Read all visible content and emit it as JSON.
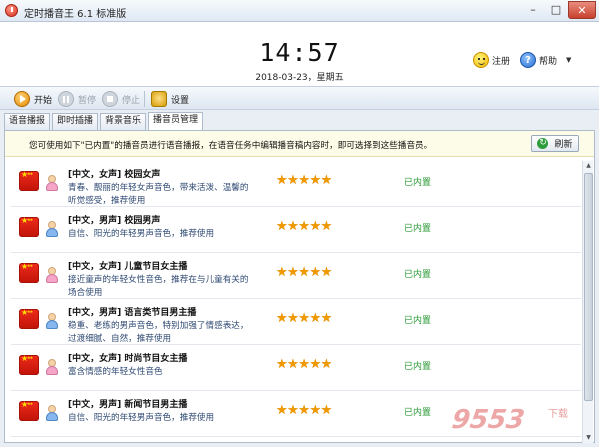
{
  "window": {
    "title": "定时播音王 6.1 标准版",
    "minimize": "–",
    "maximize": "□",
    "close": "✕"
  },
  "header": {
    "clock": "14:57",
    "date": "2018-03-23，星期五",
    "register_label": "注册",
    "help_label": "帮助",
    "help_caret": "▼"
  },
  "toolbar": {
    "start_label": "开始",
    "pause_label": "暂停",
    "stop_label": "停止",
    "settings_label": "设置"
  },
  "tabs": [
    {
      "label": "语音播报"
    },
    {
      "label": "即时插播"
    },
    {
      "label": "背景音乐"
    },
    {
      "label": "播音员管理",
      "active": true
    }
  ],
  "notice": {
    "text": "您可使用如下\"已内置\"的播音员进行语音播报，在语音任务中编辑播音稿内容时，即可选择到这些播音员。",
    "refresh_label": "刷新",
    "refresh_icon": "↻"
  },
  "announcers": [
    {
      "name": "[中文，女声] 校园女声",
      "desc": "青春、靓丽的年轻女声音色，带来活泼、温馨的听觉感受，推荐使用",
      "gender": "female",
      "rating": "★★★★★",
      "status": "已内置"
    },
    {
      "name": "[中文，男声] 校园男声",
      "desc": "自信、阳光的年轻男声音色，推荐使用",
      "gender": "male",
      "rating": "★★★★★",
      "status": "已内置"
    },
    {
      "name": "[中文，女声] 儿童节目女主播",
      "desc": "接近童声的年轻女性音色，推荐在与儿童有关的场合使用",
      "gender": "female",
      "rating": "★★★★★",
      "status": "已内置"
    },
    {
      "name": "[中文，男声] 语言类节目男主播",
      "desc": "稳重、老练的男声音色，特别加强了情感表达，过渡细腻、自然，推荐使用",
      "gender": "male",
      "rating": "★★★★★",
      "status": "已内置"
    },
    {
      "name": "[中文，女声] 时尚节目女主播",
      "desc": "富含情感的年轻女性音色",
      "gender": "female",
      "rating": "★★★★★",
      "status": "已内置"
    },
    {
      "name": "[中文，男声] 新闻节目男主播",
      "desc": "自信、阳光的年轻男声音色，推荐使用",
      "gender": "male",
      "rating": "★★★★★",
      "status": "已内置"
    }
  ],
  "watermark": {
    "logo": "9553",
    "sub": "下载"
  }
}
